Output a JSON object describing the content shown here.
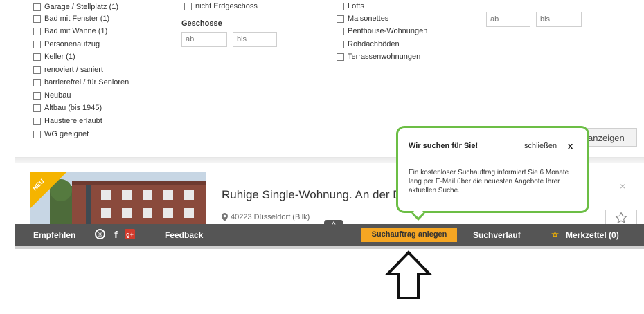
{
  "filters": {
    "col1": [
      {
        "label": "Garage / Stellplatz  (1)"
      },
      {
        "label": "Bad mit Fenster  (1)"
      },
      {
        "label": "Bad mit Wanne  (1)"
      },
      {
        "label": "Personenaufzug"
      },
      {
        "label": "Keller  (1)"
      },
      {
        "label": "renoviert / saniert"
      },
      {
        "label": "barrierefrei / für Senioren"
      },
      {
        "label": "Neubau"
      },
      {
        "label": "Altbau (bis 1945)"
      },
      {
        "label": "Haustiere erlaubt"
      },
      {
        "label": "WG geeignet"
      }
    ],
    "col2_top": {
      "label": "nicht Erdgeschoss"
    },
    "geschosse": {
      "label": "Geschosse",
      "from_placeholder": "ab",
      "to_placeholder": "bis"
    },
    "col3": [
      {
        "label": "Lofts"
      },
      {
        "label": "Maisonettes"
      },
      {
        "label": "Penthouse-Wohnungen"
      },
      {
        "label": "Rohdachböden"
      },
      {
        "label": "Terrassenwohnungen"
      }
    ],
    "col4": {
      "from_placeholder": "ab",
      "to_placeholder": "bis"
    },
    "submit_label": "anzeigen"
  },
  "listing": {
    "badge": "NEU",
    "title": "Ruhige Single-Wohnung. An der D",
    "location": "40223 Düsseldorf (Bilk)",
    "close_icon": "close-icon"
  },
  "popup": {
    "title": "Wir suchen für Sie!",
    "close_label": "schließen",
    "close_glyph": "x",
    "body": "Ein kostenloser Suchauftrag informiert Sie 6 Monate lang per E-Mail über die neuesten Angebote Ihrer aktuellen Suche."
  },
  "toolbar": {
    "empfehlen": "Empfehlen",
    "feedback": "Feedback",
    "suchauftrag": "Suchauftrag anlegen",
    "suchverlauf": "Suchverlauf",
    "merkzettel": "Merkzettel (0)",
    "caret": "^",
    "colors": {
      "bar": "#555555",
      "accent": "#f5a623",
      "popup_border": "#6cbe45"
    }
  }
}
